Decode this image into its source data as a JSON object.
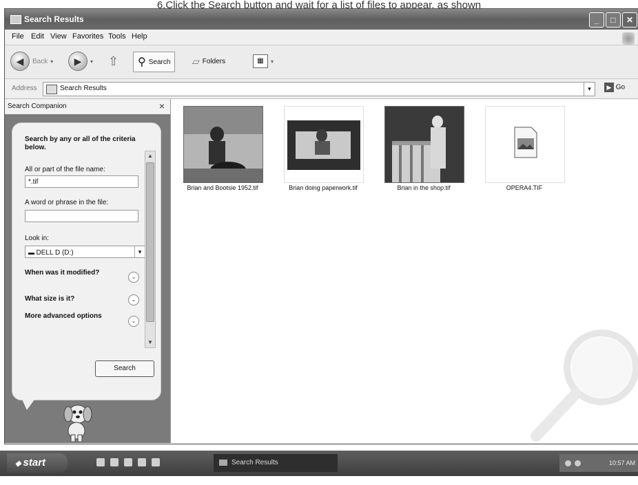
{
  "caption": "6.Click the Search button and wait for a list of files to appear, as shown",
  "window": {
    "title": "Search Results",
    "minimize_label": "_",
    "maximize_label": "□",
    "close_label": "✕"
  },
  "menu": [
    "File",
    "Edit",
    "View",
    "Favorites",
    "Tools",
    "Help"
  ],
  "toolbar": {
    "back_label": "Back",
    "search_label": "Search",
    "folders_label": "Folders"
  },
  "address": {
    "label": "Address",
    "value": "Search Results",
    "go_label": "Go"
  },
  "pane": {
    "title": "Search Companion",
    "close_label": "×",
    "heading": "Search by any or all of the criteria below.",
    "filename_label": "All or part of the file name:",
    "filename_value": "*.tif",
    "phrase_label": "A word or phrase in the file:",
    "phrase_value": "",
    "lookin_label": "Look in:",
    "lookin_value": "DELL D (D:)",
    "options": [
      "When was it modified?",
      "What size is it?",
      "More advanced options"
    ],
    "search_button": "Search"
  },
  "files": [
    {
      "name": "Brian and Bootsie 1952.tif"
    },
    {
      "name": "Brian doing paperwork.tif"
    },
    {
      "name": "Brian in the shop.tif"
    },
    {
      "name": "OPERA4.TIF"
    }
  ],
  "taskbar": {
    "start_label": "start",
    "task_label": "Search Results",
    "clock": "10:57 AM"
  }
}
